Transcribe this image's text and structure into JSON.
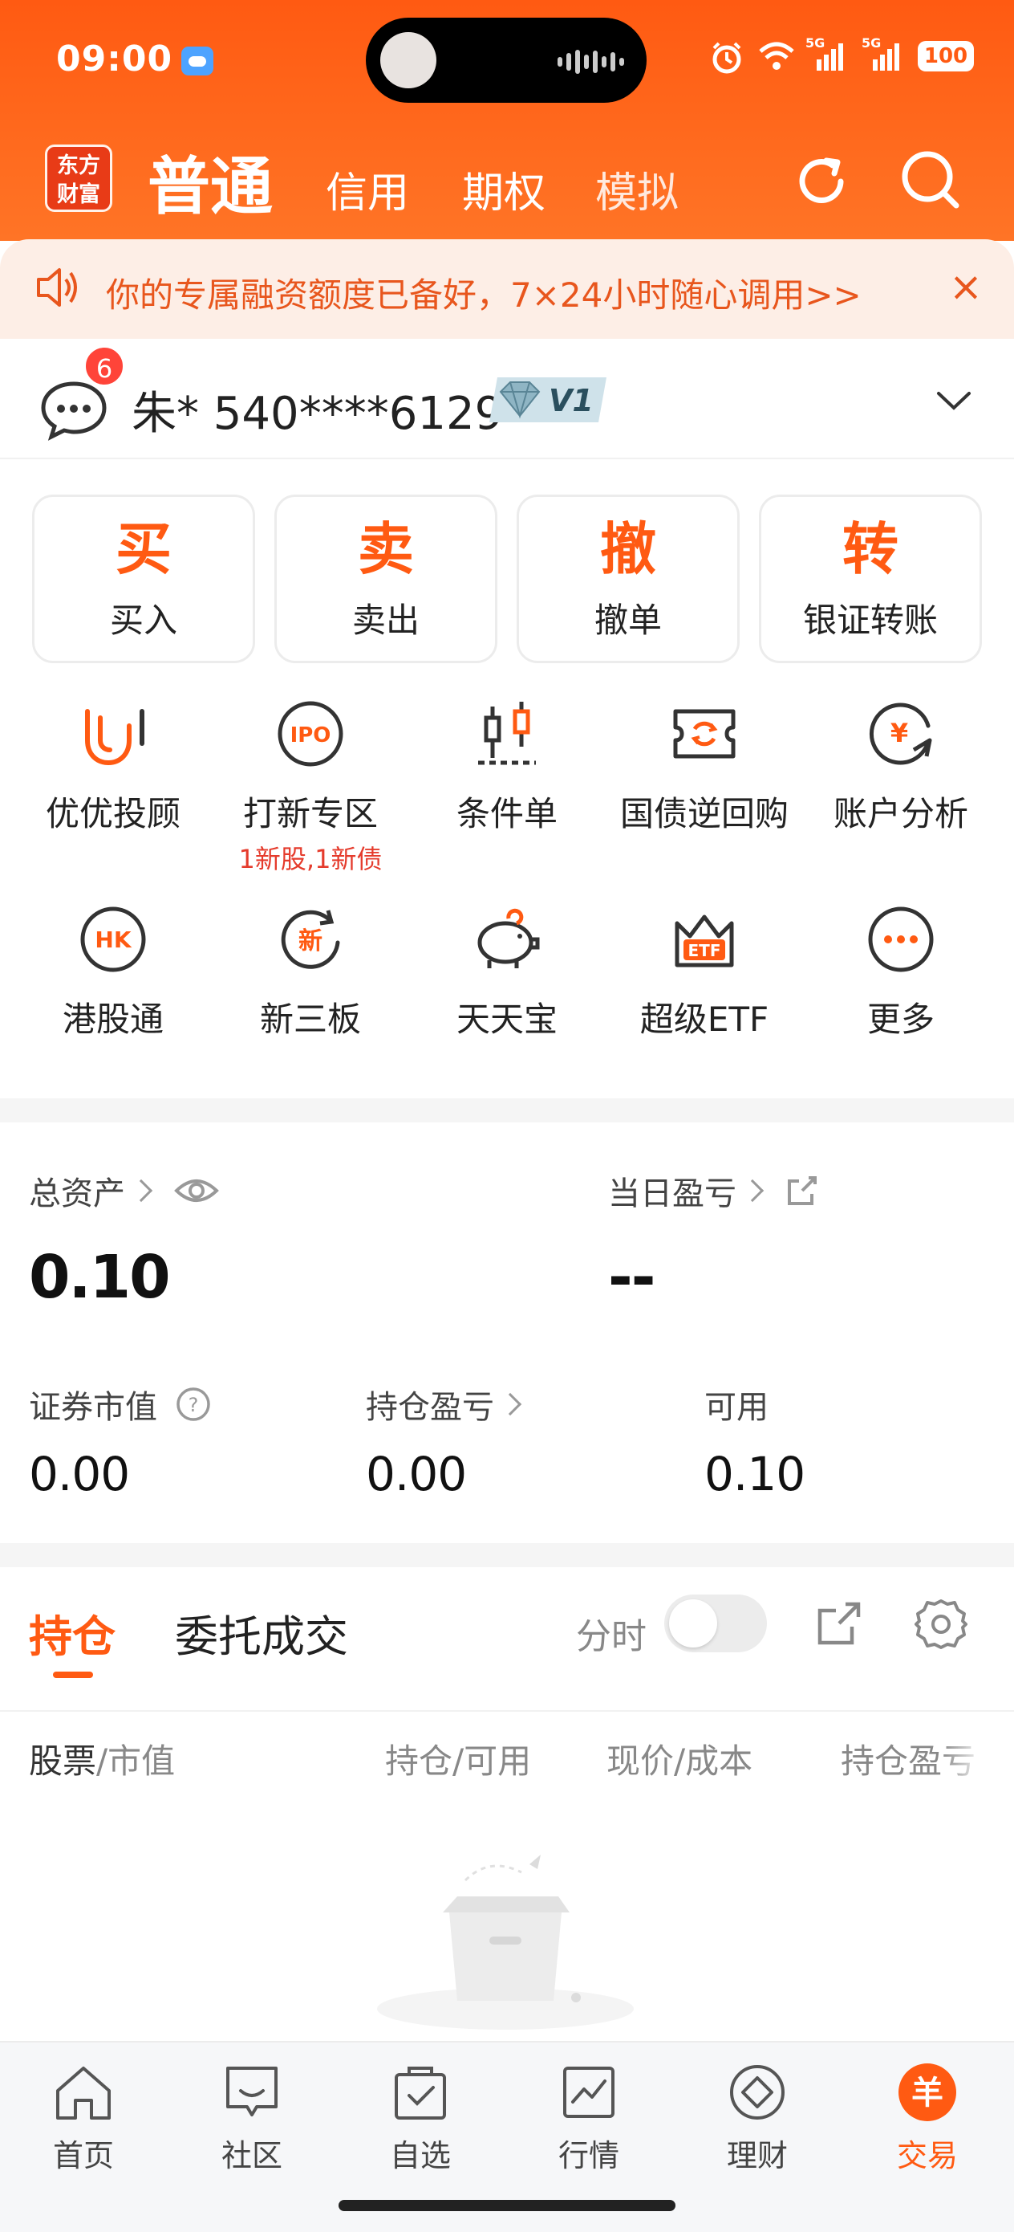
{
  "status_bar": {
    "time": "09:00",
    "battery": "100",
    "signal_1": "5G",
    "signal_2": "5G"
  },
  "header": {
    "logo_line1": "东方",
    "logo_line2": "财富",
    "tabs": [
      {
        "label": "普通",
        "active": true
      },
      {
        "label": "信用",
        "active": false
      },
      {
        "label": "期权",
        "active": false
      },
      {
        "label": "模拟",
        "active": false
      }
    ],
    "brand_color": "#ff5a12"
  },
  "promo": {
    "text": "你的专属融资额度已备好，7×24小时随心调用>>",
    "close": "×"
  },
  "account": {
    "message_badge": "6",
    "name": "朱* 540****6129",
    "vip_level": "V1"
  },
  "actions": [
    {
      "big": "买",
      "label": "买入"
    },
    {
      "big": "卖",
      "label": "卖出"
    },
    {
      "big": "撤",
      "label": "撤单"
    },
    {
      "big": "转",
      "label": "银证转账"
    }
  ],
  "tools_row1": [
    {
      "label": "优优投顾",
      "icon": "advisor-icon"
    },
    {
      "label": "打新专区",
      "sub": "1新股,1新债",
      "icon": "ipo-icon"
    },
    {
      "label": "条件单",
      "icon": "candlestick-icon"
    },
    {
      "label": "国债逆回购",
      "icon": "repo-icon"
    },
    {
      "label": "账户分析",
      "icon": "account-analysis-icon"
    }
  ],
  "tools_row2": [
    {
      "label": "港股通",
      "icon": "hk-icon"
    },
    {
      "label": "新三板",
      "icon": "new-third-board-icon"
    },
    {
      "label": "天天宝",
      "icon": "piggy-bank-icon"
    },
    {
      "label": "超级ETF",
      "icon": "etf-crown-icon"
    },
    {
      "label": "更多",
      "icon": "more-icon"
    }
  ],
  "assets": {
    "total_label": "总资产",
    "total_value": "0.10",
    "daily_pl_label": "当日盈亏",
    "daily_pl_value": "--",
    "securities_label": "证券市值",
    "securities_value": "0.00",
    "holding_pl_label": "持仓盈亏",
    "holding_pl_value": "0.00",
    "available_label": "可用",
    "available_value": "0.10"
  },
  "positions": {
    "tab_active": "持仓",
    "tab_other": "委托成交",
    "timeshare_label": "分时",
    "columns": {
      "stock": "股票",
      "market_value": "/市值",
      "holding": "持仓/可用",
      "price": "现价/成本",
      "pl": "持仓盈亏"
    }
  },
  "bottom_nav": [
    {
      "label": "首页",
      "icon": "home-icon",
      "active": false
    },
    {
      "label": "社区",
      "icon": "community-icon",
      "active": false
    },
    {
      "label": "自选",
      "icon": "watchlist-icon",
      "active": false
    },
    {
      "label": "行情",
      "icon": "market-chart-icon",
      "active": false
    },
    {
      "label": "理财",
      "icon": "wealth-icon",
      "active": false
    },
    {
      "label": "交易",
      "icon": "trade-icon",
      "active": true
    }
  ]
}
